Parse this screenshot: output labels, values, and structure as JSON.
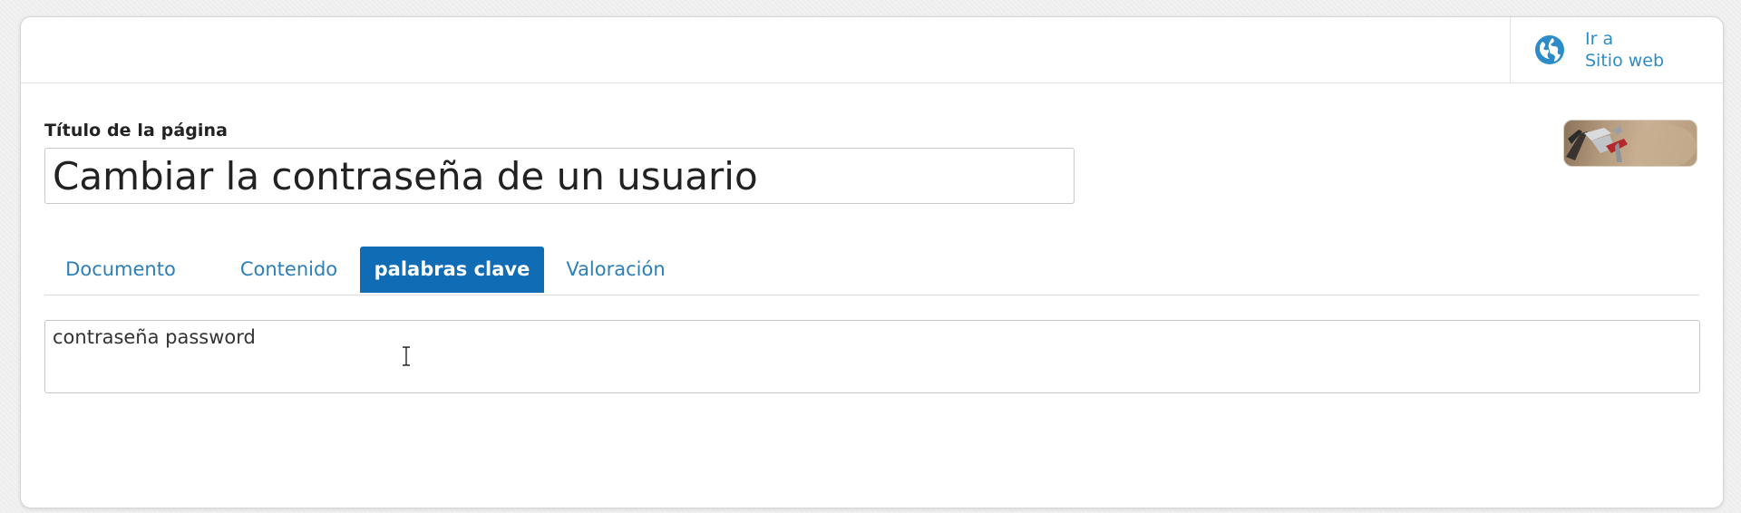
{
  "header": {
    "goto_site": {
      "line1": "Ir a",
      "line2": "Sitio web",
      "icon": "globe-icon"
    }
  },
  "form": {
    "title_label": "Título de la página",
    "title_value": "Cambiar la contraseña de un usuario",
    "thumbnail": "tools-image"
  },
  "tabs": [
    {
      "label": "Documento",
      "active": false
    },
    {
      "label": "Contenido",
      "active": false
    },
    {
      "label": "palabras clave",
      "active": true
    },
    {
      "label": "Valoración",
      "active": false
    }
  ],
  "keywords": {
    "value": "contraseña password"
  },
  "colors": {
    "accent": "#0f6cb5",
    "link": "#2d8cc8"
  }
}
